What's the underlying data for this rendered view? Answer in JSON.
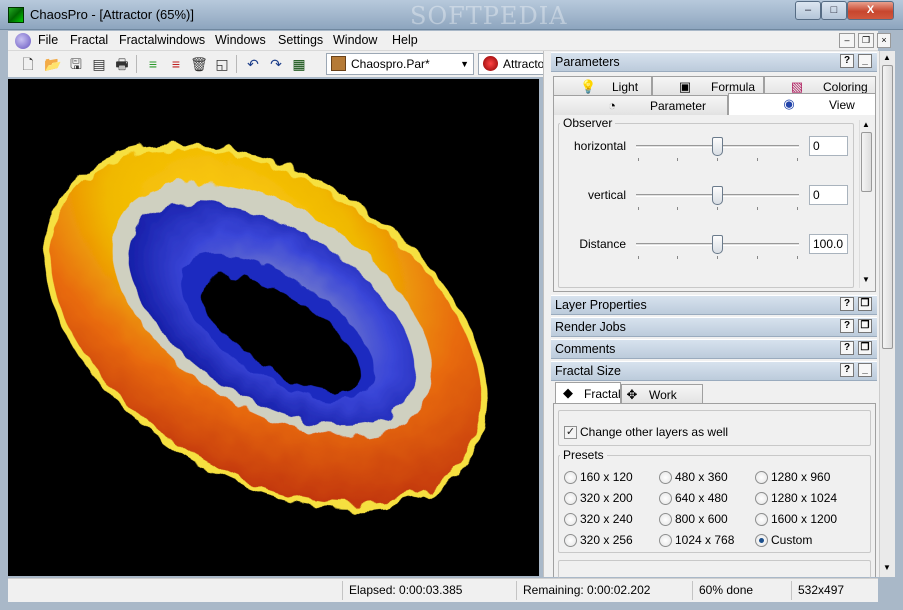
{
  "window": {
    "title": "ChaosPro - [Attractor (65%)]",
    "watermark": "SOFTPEDIA",
    "min_label": "–",
    "max_label": "□",
    "close_label": "X"
  },
  "menubar": {
    "items": [
      "File",
      "Fractal",
      "Fractalwindows",
      "Windows",
      "Settings",
      "Window",
      "Help"
    ]
  },
  "toolbar": {
    "combo_value": "Chaospro.Par*",
    "second_combo_value": "Attracto"
  },
  "panels": {
    "parameters": {
      "title": "Parameters",
      "help": "?",
      "minimize": "_"
    },
    "tabs_row1": [
      "Light",
      "Formula",
      "Coloring"
    ],
    "tabs_row2": [
      "Parameter",
      "View"
    ],
    "active_tab": "View",
    "observer": {
      "group_label": "Observer",
      "sliders": [
        {
          "label": "horizontal",
          "value": "0",
          "position": 0.5
        },
        {
          "label": "vertical",
          "value": "0",
          "position": 0.5
        },
        {
          "label": "Distance",
          "value": "100.0",
          "position": 0.5
        }
      ]
    },
    "collapsed": [
      "Layer Properties",
      "Render Jobs",
      "Comments"
    ],
    "fractal_size": {
      "title": "Fractal Size",
      "tabs": [
        "Fractal",
        "Work Area"
      ],
      "change_layers_label": "Change other layers as well",
      "change_layers_checked": true,
      "presets_label": "Presets",
      "presets": [
        "160 x 120",
        "480 x 360",
        "1280 x 960",
        "320 x 200",
        "640 x 480",
        "1280 x 1024",
        "320 x 240",
        "800 x 600",
        "1600 x 1200",
        "320 x 256",
        "1024 x 768",
        "Custom"
      ],
      "selected_preset": "Custom"
    }
  },
  "statusbar": {
    "elapsed": "Elapsed: 0:00:03.385",
    "remaining": "Remaining: 0:00:02.202",
    "progress": "60% done",
    "size": "532x497",
    "progress_value": 0.6
  }
}
